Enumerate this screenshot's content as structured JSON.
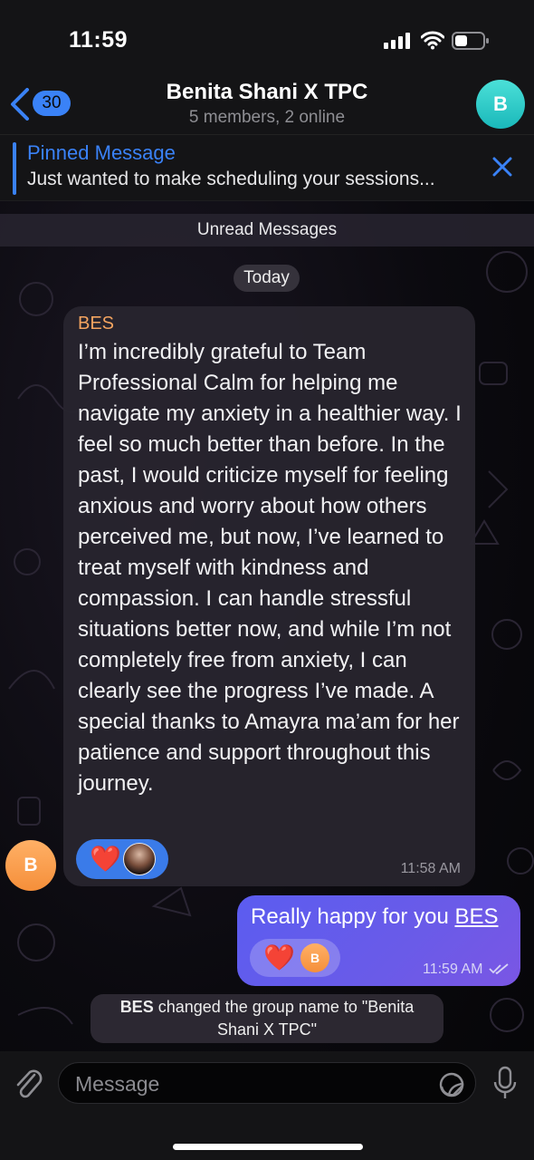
{
  "status_bar": {
    "time": "11:59"
  },
  "header": {
    "unread_count": "30",
    "title": "Benita Shani X TPC",
    "subtitle": "5 members, 2 online",
    "avatar_letter": "B"
  },
  "pinned": {
    "title": "Pinned Message",
    "text": "Just wanted to make scheduling your sessions..."
  },
  "unread_label": "Unread Messages",
  "date_label": "Today",
  "messages": [
    {
      "sender": "BES",
      "text": "I’m incredibly grateful to Team Professional Calm for helping me navigate my anxiety in a healthier way. I feel so much better than before. In the past, I would criticize myself for feeling anxious and worry about how others perceived me, but now, I’ve learned to treat myself with kindness and compassion. I can handle stressful situations better now, and while I’m not completely free from anxiety, I can clearly see the progress I’ve made. A special thanks to Amayra ma’am for her patience and support throughout this journey.",
      "time": "11:58 AM",
      "avatar_letter": "B",
      "reaction": "❤️"
    },
    {
      "text_prefix": "Really happy for you ",
      "mention": "BES",
      "time": "11:59 AM",
      "reaction": "❤️",
      "reactor_letter": "B"
    }
  ],
  "service_message": {
    "actor": "BES",
    "text": " changed the group name to \"Benita Shani X TPC\""
  },
  "input": {
    "placeholder": "Message"
  },
  "colors": {
    "accent": "#3a82f7",
    "outgoing": "#5b5cf0",
    "sender": "#f4a460"
  }
}
